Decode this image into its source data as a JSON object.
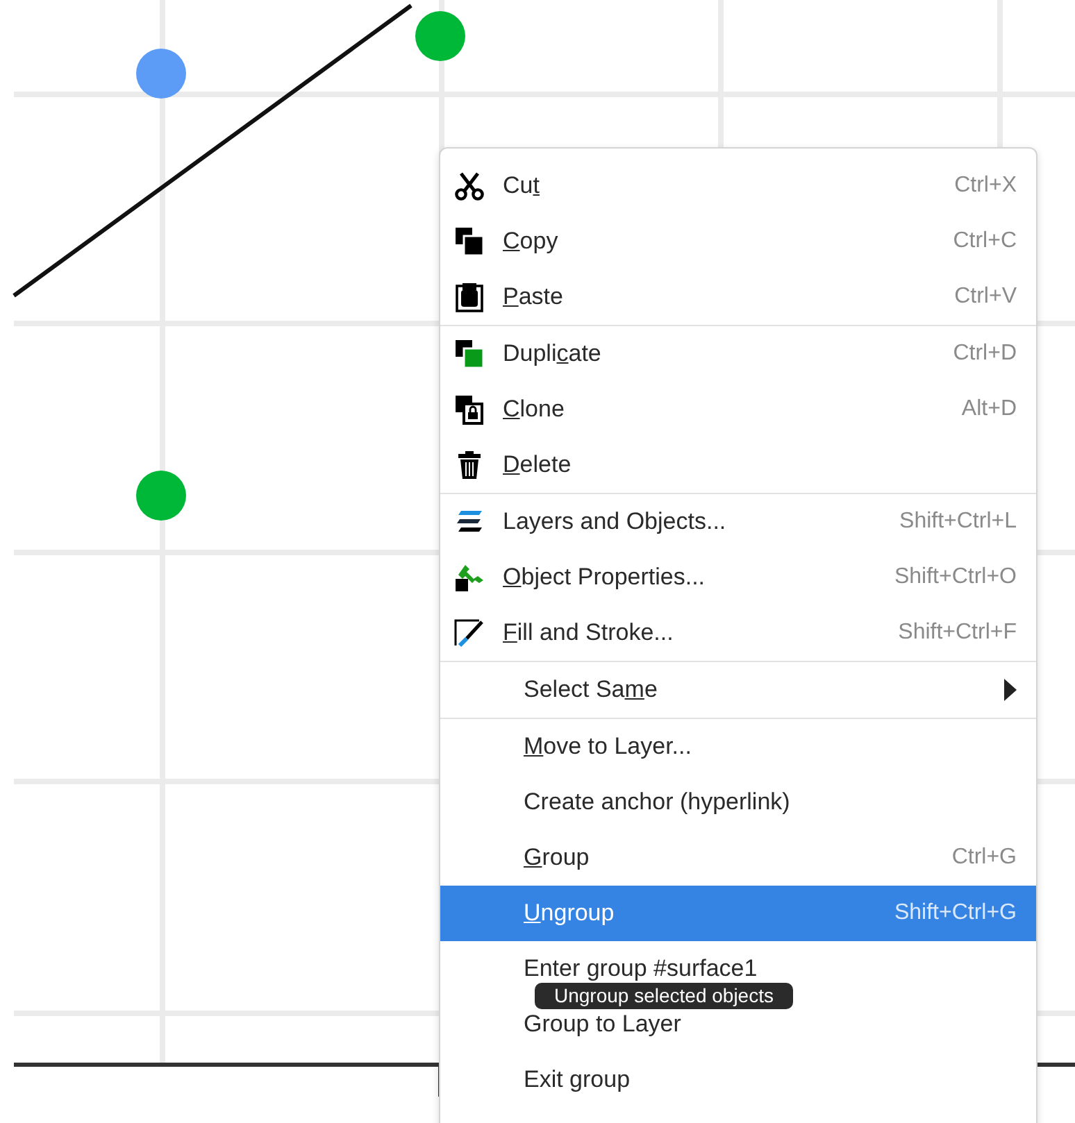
{
  "context_menu": {
    "sections": [
      {
        "items": [
          {
            "label": {
              "before": "Cu",
              "key": "t"
            },
            "shortcut": "Ctrl+X",
            "selected": false
          },
          {
            "label": {
              "key": "C",
              "after": "opy"
            },
            "shortcut": "Ctrl+C",
            "selected": false
          },
          {
            "label": {
              "key": "P",
              "after": "aste"
            },
            "shortcut": "Ctrl+V",
            "selected": false
          }
        ]
      },
      {
        "items": [
          {
            "label": {
              "before": "Dupli",
              "key": "c",
              "after": "ate"
            },
            "shortcut": "Ctrl+D",
            "selected": false
          },
          {
            "label": {
              "key": "C",
              "after": "lone"
            },
            "shortcut": "Alt+D",
            "selected": false
          },
          {
            "label": {
              "key": "D",
              "after": "elete"
            },
            "selected": false
          }
        ]
      },
      {
        "items": [
          {
            "label": {
              "before": "Layers and Objects..."
            },
            "shortcut": "Shift+Ctrl+L",
            "selected": false
          },
          {
            "label": {
              "key": "O",
              "after": "bject Properties..."
            },
            "shortcut": "Shift+Ctrl+O",
            "selected": false
          },
          {
            "label": {
              "key": "F",
              "after": "ill and Stroke..."
            },
            "shortcut": "Shift+Ctrl+F",
            "selected": false
          }
        ]
      },
      {
        "items": [
          {
            "label": {
              "before": "Select Sa",
              "key": "m",
              "after": "e"
            },
            "submenu": true,
            "selected": false
          }
        ]
      },
      {
        "items": [
          {
            "label": {
              "key": "M",
              "after": "ove to Layer..."
            },
            "selected": false
          },
          {
            "label": {
              "before": "Create anchor (hyperlink)"
            },
            "selected": false
          },
          {
            "label": {
              "key": "G",
              "after": "roup"
            },
            "shortcut": "Ctrl+G",
            "selected": false
          },
          {
            "label": {
              "key": "U",
              "after": "ngroup"
            },
            "shortcut": "Shift+Ctrl+G",
            "selected": true
          },
          {
            "label": {
              "before": "Enter group #surface1"
            },
            "selected": false
          },
          {
            "label": {
              "before": "Group to Layer"
            },
            "selected": false
          },
          {
            "label": {
              "before": "Exit group"
            },
            "selected": false
          }
        ]
      }
    ]
  },
  "tooltip": {
    "text": "Ungroup selected objects"
  }
}
